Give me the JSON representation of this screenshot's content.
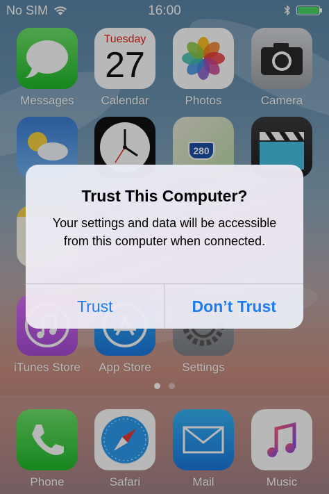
{
  "status_bar": {
    "carrier": "No SIM",
    "time": "16:00",
    "battery_fill": 1.0
  },
  "home": {
    "row1": [
      {
        "label": "Messages",
        "icon": "messages-icon"
      },
      {
        "label": "Calendar",
        "icon": "calendar-icon",
        "day_name": "Tuesday",
        "day_number": "27"
      },
      {
        "label": "Photos",
        "icon": "photos-icon"
      },
      {
        "label": "Camera",
        "icon": "camera-icon"
      }
    ],
    "row2": [
      {
        "label": "",
        "icon": "weather-icon"
      },
      {
        "label": "",
        "icon": "clock-icon"
      },
      {
        "label": "",
        "icon": "maps-icon",
        "sign": "280"
      },
      {
        "label": "",
        "icon": "videos-icon"
      }
    ],
    "row4": [
      {
        "label": "iTunes Store",
        "icon": "itunes-store-icon"
      },
      {
        "label": "App Store",
        "icon": "app-store-icon"
      },
      {
        "label": "Settings",
        "icon": "settings-icon"
      }
    ],
    "page_count": 2,
    "active_page": 0
  },
  "dock": [
    {
      "label": "Phone",
      "icon": "phone-icon"
    },
    {
      "label": "Safari",
      "icon": "safari-icon"
    },
    {
      "label": "Mail",
      "icon": "mail-icon"
    },
    {
      "label": "Music",
      "icon": "music-icon"
    }
  ],
  "alert": {
    "title": "Trust This Computer?",
    "message": "Your settings and data will be accessible from this computer when connected.",
    "trust_label": "Trust",
    "dont_trust_label": "Don’t Trust"
  },
  "colors": {
    "accent": "#1e7cf2",
    "battery": "#4cd964"
  }
}
